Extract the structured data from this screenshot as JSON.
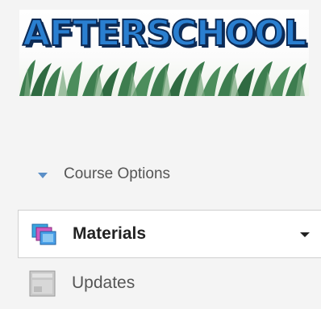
{
  "banner": {
    "title": "AFTERSCHOOL"
  },
  "course_options": {
    "label": "Course Options",
    "icon": "caret-down-icon"
  },
  "nav": {
    "materials": {
      "label": "Materials",
      "icon": "materials-icon",
      "dropdown_icon": "caret-down-icon"
    },
    "updates": {
      "label": "Updates",
      "icon": "updates-icon"
    }
  },
  "colors": {
    "accent": "#5b8fc7",
    "banner_text": "#2a7fd0",
    "banner_outline": "#0c2a55"
  }
}
